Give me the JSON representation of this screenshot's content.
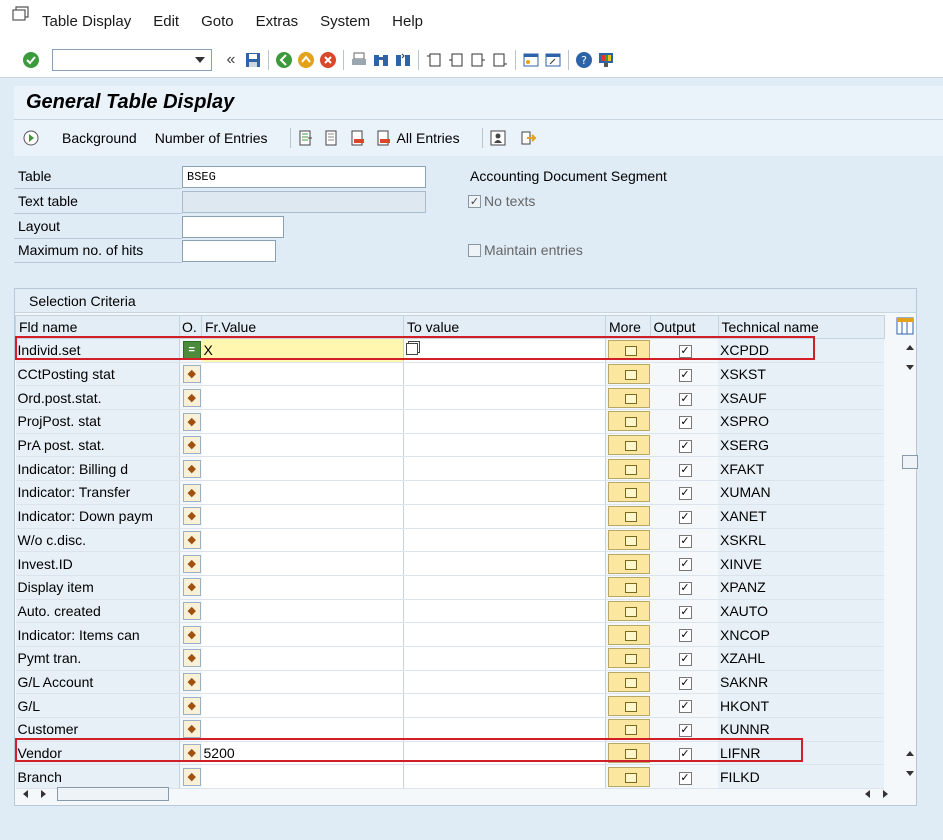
{
  "menu": {
    "items": [
      "Table Display",
      "Edit",
      "Goto",
      "Extras",
      "System",
      "Help"
    ]
  },
  "toolbar": {
    "command_value": ""
  },
  "title": "General Table Display",
  "appbar": {
    "background": "Background",
    "number_of_entries": "Number of Entries",
    "all_entries": "All Entries"
  },
  "form": {
    "table_label": "Table",
    "table_value": "BSEG",
    "table_desc": "Accounting Document Segment",
    "text_table_label": "Text table",
    "no_texts_label": "No texts",
    "no_texts_checked": true,
    "layout_label": "Layout",
    "max_hits_label": "Maximum no. of hits",
    "maintain_entries_label": "Maintain entries",
    "maintain_entries_checked": false
  },
  "grid": {
    "title": "Selection Criteria",
    "headers": {
      "fld": "Fld name",
      "op": "O.",
      "fr": "Fr.Value",
      "to": "To value",
      "more": "More",
      "out": "Output",
      "tech": "Technical name"
    },
    "rows": [
      {
        "fld": "Individ.set",
        "op": "=",
        "fr": "X",
        "to": "",
        "tech": "XCPDD",
        "output": true
      },
      {
        "fld": "CCtPosting stat",
        "op": "",
        "fr": "",
        "to": "",
        "tech": "XSKST",
        "output": true
      },
      {
        "fld": "Ord.post.stat.",
        "op": "",
        "fr": "",
        "to": "",
        "tech": "XSAUF",
        "output": true
      },
      {
        "fld": "ProjPost. stat",
        "op": "",
        "fr": "",
        "to": "",
        "tech": "XSPRO",
        "output": true
      },
      {
        "fld": "PrA post. stat.",
        "op": "",
        "fr": "",
        "to": "",
        "tech": "XSERG",
        "output": true
      },
      {
        "fld": "Indicator: Billing d",
        "op": "",
        "fr": "",
        "to": "",
        "tech": "XFAKT",
        "output": true
      },
      {
        "fld": "Indicator: Transfer",
        "op": "",
        "fr": "",
        "to": "",
        "tech": "XUMAN",
        "output": true
      },
      {
        "fld": "Indicator: Down paym",
        "op": "",
        "fr": "",
        "to": "",
        "tech": "XANET",
        "output": true
      },
      {
        "fld": "W/o c.disc.",
        "op": "",
        "fr": "",
        "to": "",
        "tech": "XSKRL",
        "output": true
      },
      {
        "fld": "Invest.ID",
        "op": "",
        "fr": "",
        "to": "",
        "tech": "XINVE",
        "output": true
      },
      {
        "fld": "Display item",
        "op": "",
        "fr": "",
        "to": "",
        "tech": "XPANZ",
        "output": true
      },
      {
        "fld": "Auto. created",
        "op": "",
        "fr": "",
        "to": "",
        "tech": "XAUTO",
        "output": true
      },
      {
        "fld": "Indicator: Items can",
        "op": "",
        "fr": "",
        "to": "",
        "tech": "XNCOP",
        "output": true
      },
      {
        "fld": "Pymt tran.",
        "op": "",
        "fr": "",
        "to": "",
        "tech": "XZAHL",
        "output": true
      },
      {
        "fld": "G/L Account",
        "op": "",
        "fr": "",
        "to": "",
        "tech": "SAKNR",
        "output": true
      },
      {
        "fld": "G/L",
        "op": "",
        "fr": "",
        "to": "",
        "tech": "HKONT",
        "output": true
      },
      {
        "fld": "Customer",
        "op": "",
        "fr": "",
        "to": "",
        "tech": "KUNNR",
        "output": true
      },
      {
        "fld": "Vendor",
        "op": "",
        "fr": "5200",
        "to": "",
        "tech": "LIFNR",
        "output": true
      },
      {
        "fld": "Branch",
        "op": "",
        "fr": "",
        "to": "",
        "tech": "FILKD",
        "output": true
      }
    ]
  },
  "colors": {
    "highlight_box": "#d21f27",
    "header_bg": "#e3edf5",
    "active_field_bg": "#fff6b0"
  }
}
